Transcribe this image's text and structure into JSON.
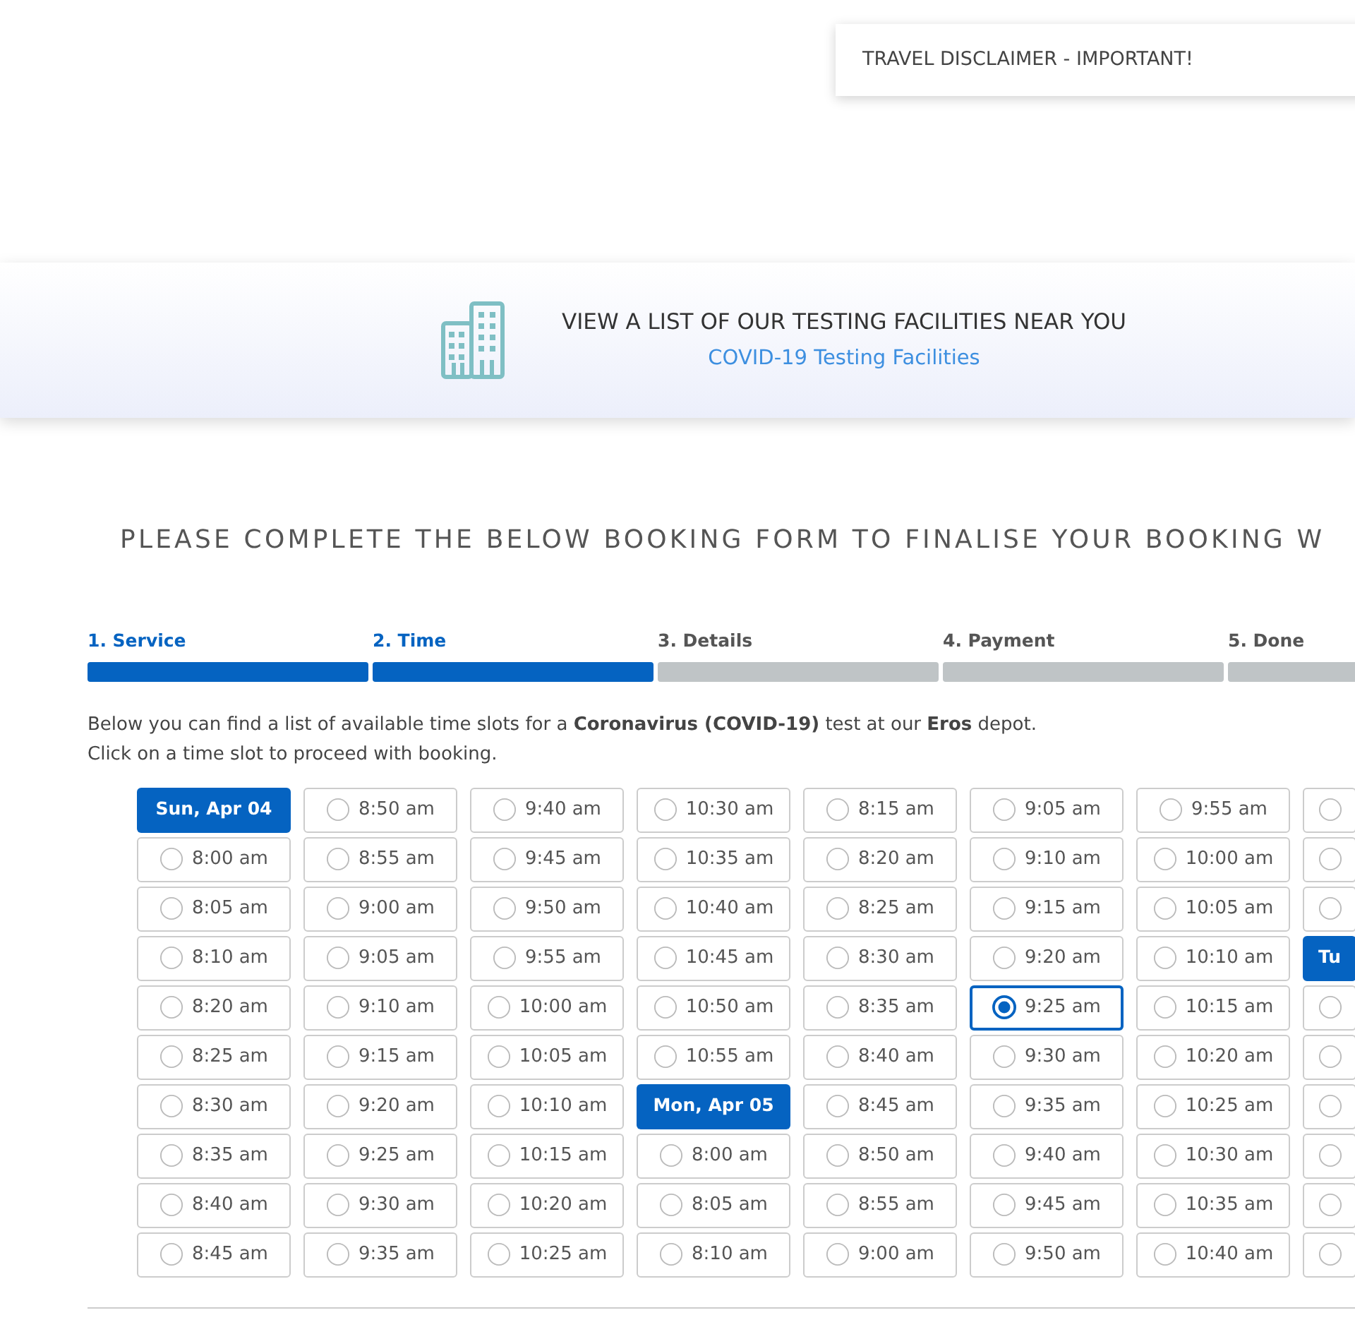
{
  "disclaimer": {
    "title": "TRAVEL DISCLAIMER - IMPORTANT!"
  },
  "facilities_banner": {
    "heading": "VIEW A LIST OF OUR TESTING FACILITIES NEAR YOU",
    "link": "COVID-19 Testing Facilities"
  },
  "form_heading": "PLEASE COMPLETE THE BELOW BOOKING FORM TO FINALISE YOUR BOOKING W",
  "steps": [
    {
      "label": "1. Service",
      "done": true
    },
    {
      "label": "2. Time",
      "done": true
    },
    {
      "label": "3. Details",
      "done": false
    },
    {
      "label": "4. Payment",
      "done": false
    },
    {
      "label": "5. Done",
      "done": false
    }
  ],
  "intro": [
    "Below you can find a list of available time slots for a **Coronavirus (COVID-19)** test at our **Eros** depot.",
    "Click on a time slot to proceed with booking."
  ],
  "slots": [
    {
      "kind": "date",
      "label": "Sun, Apr 04"
    },
    {
      "kind": "slot",
      "time": "8:00 am",
      "selected": false
    },
    {
      "kind": "slot",
      "time": "8:05 am",
      "selected": false
    },
    {
      "kind": "slot",
      "time": "8:10 am",
      "selected": false
    },
    {
      "kind": "slot",
      "time": "8:20 am",
      "selected": false
    },
    {
      "kind": "slot",
      "time": "8:25 am",
      "selected": false
    },
    {
      "kind": "slot",
      "time": "8:30 am",
      "selected": false
    },
    {
      "kind": "slot",
      "time": "8:35 am",
      "selected": false
    },
    {
      "kind": "slot",
      "time": "8:40 am",
      "selected": false
    },
    {
      "kind": "slot",
      "time": "8:45 am",
      "selected": false
    },
    {
      "kind": "slot",
      "time": "8:50 am",
      "selected": false
    },
    {
      "kind": "slot",
      "time": "8:55 am",
      "selected": false
    },
    {
      "kind": "slot",
      "time": "9:00 am",
      "selected": false
    },
    {
      "kind": "slot",
      "time": "9:05 am",
      "selected": false
    },
    {
      "kind": "slot",
      "time": "9:10 am",
      "selected": false
    },
    {
      "kind": "slot",
      "time": "9:15 am",
      "selected": false
    },
    {
      "kind": "slot",
      "time": "9:20 am",
      "selected": false
    },
    {
      "kind": "slot",
      "time": "9:25 am",
      "selected": false
    },
    {
      "kind": "slot",
      "time": "9:30 am",
      "selected": false
    },
    {
      "kind": "slot",
      "time": "9:35 am",
      "selected": false
    },
    {
      "kind": "slot",
      "time": "9:40 am",
      "selected": false
    },
    {
      "kind": "slot",
      "time": "9:45 am",
      "selected": false
    },
    {
      "kind": "slot",
      "time": "9:50 am",
      "selected": false
    },
    {
      "kind": "slot",
      "time": "9:55 am",
      "selected": false
    },
    {
      "kind": "slot",
      "time": "10:00 am",
      "selected": false
    },
    {
      "kind": "slot",
      "time": "10:05 am",
      "selected": false
    },
    {
      "kind": "slot",
      "time": "10:10 am",
      "selected": false
    },
    {
      "kind": "slot",
      "time": "10:15 am",
      "selected": false
    },
    {
      "kind": "slot",
      "time": "10:20 am",
      "selected": false
    },
    {
      "kind": "slot",
      "time": "10:25 am",
      "selected": false
    },
    {
      "kind": "slot",
      "time": "10:30 am",
      "selected": false
    },
    {
      "kind": "slot",
      "time": "10:35 am",
      "selected": false
    },
    {
      "kind": "slot",
      "time": "10:40 am",
      "selected": false
    },
    {
      "kind": "slot",
      "time": "10:45 am",
      "selected": false
    },
    {
      "kind": "slot",
      "time": "10:50 am",
      "selected": false
    },
    {
      "kind": "slot",
      "time": "10:55 am",
      "selected": false
    },
    {
      "kind": "date",
      "label": "Mon, Apr 05"
    },
    {
      "kind": "slot",
      "time": "8:00 am",
      "selected": false
    },
    {
      "kind": "slot",
      "time": "8:05 am",
      "selected": false
    },
    {
      "kind": "slot",
      "time": "8:10 am",
      "selected": false
    },
    {
      "kind": "slot",
      "time": "8:15 am",
      "selected": false
    },
    {
      "kind": "slot",
      "time": "8:20 am",
      "selected": false
    },
    {
      "kind": "slot",
      "time": "8:25 am",
      "selected": false
    },
    {
      "kind": "slot",
      "time": "8:30 am",
      "selected": false
    },
    {
      "kind": "slot",
      "time": "8:35 am",
      "selected": false
    },
    {
      "kind": "slot",
      "time": "8:40 am",
      "selected": false
    },
    {
      "kind": "slot",
      "time": "8:45 am",
      "selected": false
    },
    {
      "kind": "slot",
      "time": "8:50 am",
      "selected": false
    },
    {
      "kind": "slot",
      "time": "8:55 am",
      "selected": false
    },
    {
      "kind": "slot",
      "time": "9:00 am",
      "selected": false
    },
    {
      "kind": "slot",
      "time": "9:05 am",
      "selected": false
    },
    {
      "kind": "slot",
      "time": "9:10 am",
      "selected": false
    },
    {
      "kind": "slot",
      "time": "9:15 am",
      "selected": false
    },
    {
      "kind": "slot",
      "time": "9:20 am",
      "selected": false
    },
    {
      "kind": "slot",
      "time": "9:25 am",
      "selected": true
    },
    {
      "kind": "slot",
      "time": "9:30 am",
      "selected": false
    },
    {
      "kind": "slot",
      "time": "9:35 am",
      "selected": false
    },
    {
      "kind": "slot",
      "time": "9:40 am",
      "selected": false
    },
    {
      "kind": "slot",
      "time": "9:45 am",
      "selected": false
    },
    {
      "kind": "slot",
      "time": "9:50 am",
      "selected": false
    },
    {
      "kind": "slot",
      "time": "9:55 am",
      "selected": false
    },
    {
      "kind": "slot",
      "time": "10:00 am",
      "selected": false
    },
    {
      "kind": "slot",
      "time": "10:05 am",
      "selected": false
    },
    {
      "kind": "slot",
      "time": "10:10 am",
      "selected": false
    },
    {
      "kind": "slot",
      "time": "10:15 am",
      "selected": false
    },
    {
      "kind": "slot",
      "time": "10:20 am",
      "selected": false
    },
    {
      "kind": "slot",
      "time": "10:25 am",
      "selected": false
    },
    {
      "kind": "slot",
      "time": "10:30 am",
      "selected": false
    },
    {
      "kind": "slot",
      "time": "10:35 am",
      "selected": false
    },
    {
      "kind": "slot",
      "time": "10:40 am",
      "selected": false
    },
    {
      "kind": "slot",
      "selected": false
    },
    {
      "kind": "slot",
      "selected": false
    },
    {
      "kind": "slot",
      "selected": false
    },
    {
      "kind": "date",
      "label": "Tu"
    },
    {
      "kind": "slot",
      "selected": false
    },
    {
      "kind": "slot",
      "selected": false
    },
    {
      "kind": "slot",
      "selected": false
    },
    {
      "kind": "slot",
      "selected": false
    },
    {
      "kind": "slot",
      "selected": false
    },
    {
      "kind": "slot",
      "selected": false
    }
  ]
}
